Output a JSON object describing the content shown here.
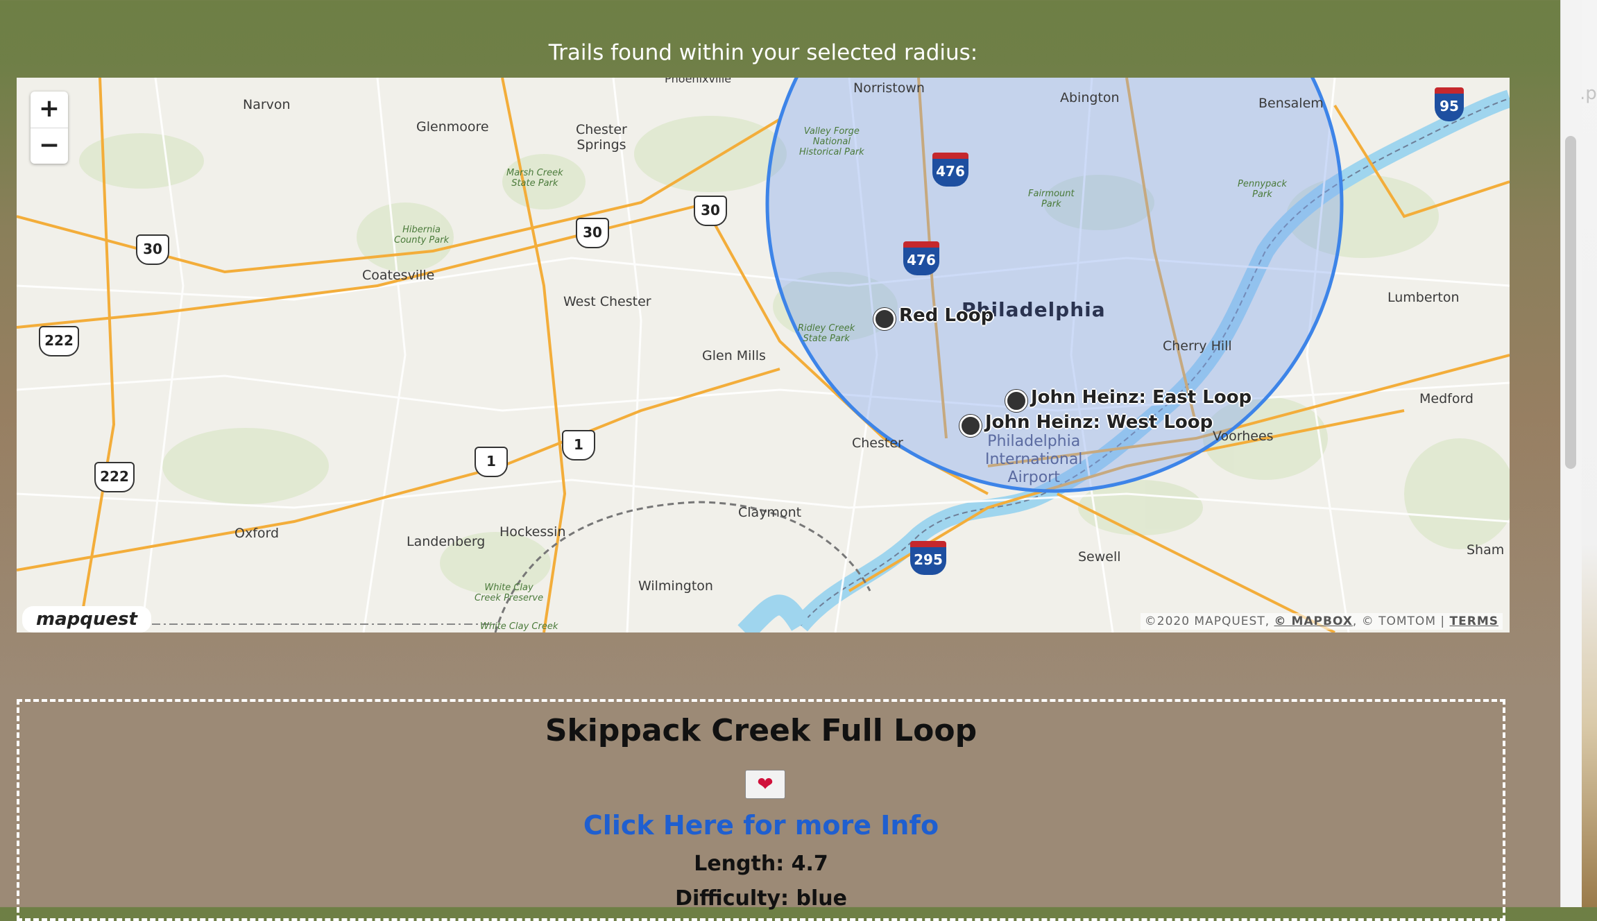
{
  "header": {
    "title": "Trails found within your selected radius:"
  },
  "map": {
    "zoom_in": "+",
    "zoom_out": "−",
    "logo": "mapquest",
    "attribution": {
      "copyright": "©2020 MAPQUEST, ",
      "mapbox": "© MAPBOX",
      "tomtom": ", © TOMTOM | ",
      "terms": "TERMS"
    },
    "markers": [
      {
        "label": "Red Loop"
      },
      {
        "label": "John Heinz: East Loop"
      },
      {
        "label": "John Heinz: West Loop"
      }
    ],
    "places": {
      "narvon": "Narvon",
      "glenmoore": "Glenmoore",
      "chester_springs": "Chester\nSprings",
      "coatesville": "Coatesville",
      "west_chester": "West Chester",
      "glen_mills": "Glen Mills",
      "norristown": "Norristown",
      "abington": "Abington",
      "bensalem": "Bensalem",
      "philadelphia": "Philadelphia",
      "cherry_hill": "Cherry Hill",
      "lumberton": "Lumberton",
      "medford": "Medford",
      "voorhees": "Voorhees",
      "chester": "Chester",
      "claymont": "Claymont",
      "sewell": "Sewell",
      "hockessin": "Hockessin",
      "landenberg": "Landenberg",
      "oxford": "Oxford",
      "wilmington": "Wilmington",
      "shamong": "Sham",
      "airport": "Philadelphia\nInternational\nAirport",
      "marsh_creek": "Marsh Creek\nState Park",
      "hibernia": "Hibernia\nCounty Park",
      "valley_forge": "Valley Forge\nNational\nHistorical Park",
      "fairmount": "Fairmount\nPark",
      "pennypack": "Pennypack\nPark",
      "ridley": "Ridley Creek\nState Park",
      "white_clay": "White Clay\nCreek Preserve",
      "white_clay_2": "White Clay Creek",
      "phoenixville": "Phoenixville"
    },
    "shields": {
      "us30a": "30",
      "us30b": "30",
      "us30c": "30",
      "us222a": "222",
      "us222b": "222",
      "us1a": "1",
      "us1b": "1",
      "us222c": "222"
    },
    "interstates": {
      "i476a": "476",
      "i476b": "476",
      "i95": "95",
      "i295": "295"
    }
  },
  "trail_card": {
    "name": "Skippack Creek Full Loop",
    "favorite_icon": "heart-icon",
    "more_info": "Click Here for more Info",
    "length": "Length: 4.7",
    "difficulty": "Difficulty: blue"
  },
  "right_fragment": ".p"
}
